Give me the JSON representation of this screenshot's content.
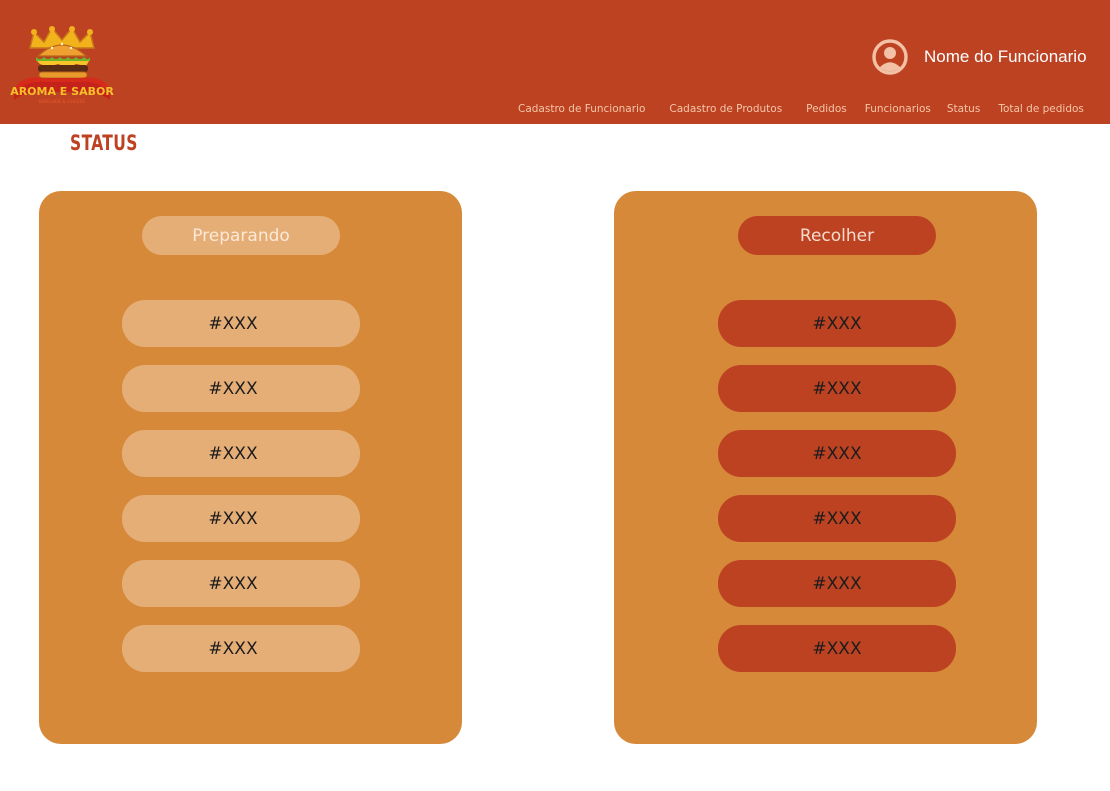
{
  "brand": {
    "logo_text": "AROMA E SABOR",
    "logo_tagline": "BURGUER & CHEESE"
  },
  "header": {
    "user_name": "Nome do Funcionario",
    "user_icon": "user-circle-icon",
    "nav": [
      "Cadastro de Funcionario",
      "Cadastro de Produtos",
      "Pedidos",
      "Funcionarios",
      "Status",
      "Total de pedidos"
    ]
  },
  "page": {
    "title": "STATUS"
  },
  "panels": {
    "preparing": {
      "title": "Preparando",
      "orders": [
        "#XXX",
        "#XXX",
        "#XXX",
        "#XXX",
        "#XXX",
        "#XXX"
      ]
    },
    "pickup": {
      "title": "Recolher",
      "orders": [
        "#XXX",
        "#XXX",
        "#XXX",
        "#XXX",
        "#XXX",
        "#XXX"
      ]
    }
  },
  "colors": {
    "header_bg": "#bd4222",
    "panel_bg": "#d58939",
    "preparing_pill": "#e6ae77",
    "pickup_pill": "#bd4222"
  }
}
